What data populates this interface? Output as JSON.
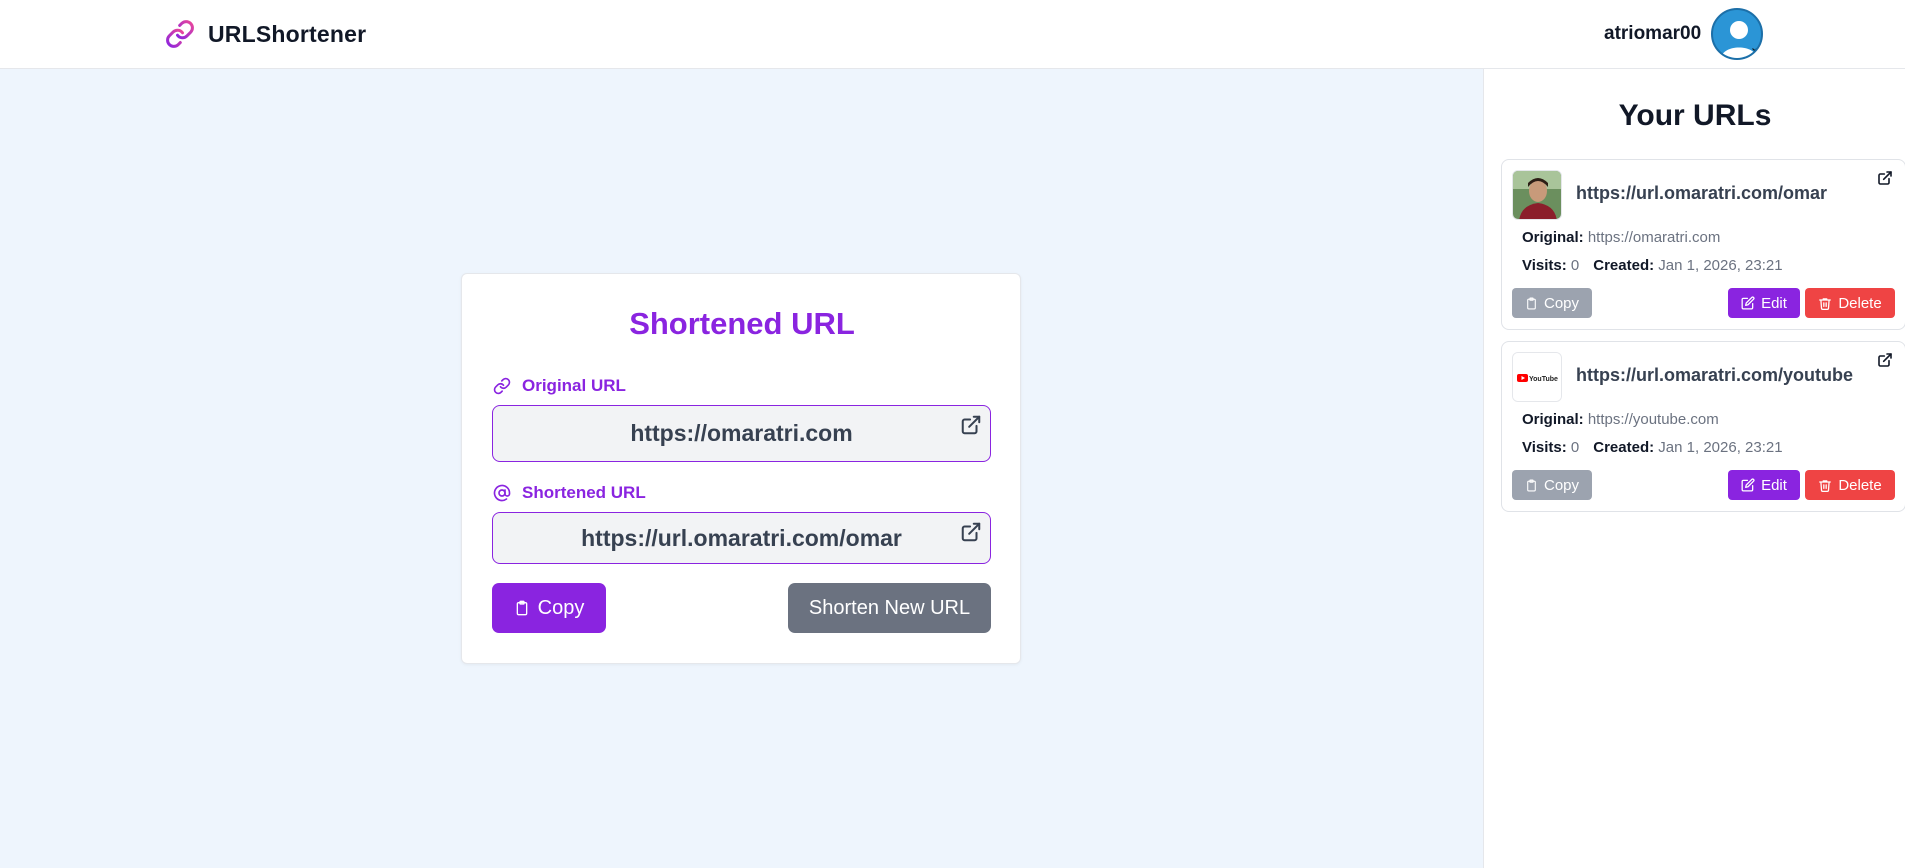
{
  "header": {
    "brand": "URLShortener",
    "username": "atriomar00",
    "avatar_chevron": "⌄"
  },
  "colors": {
    "accent": "#8a24e0",
    "background": "#eef5fd",
    "gray_button": "#6b7280",
    "danger": "#ef4444",
    "avatar": "#2b95d6"
  },
  "card": {
    "title": "Shortened URL",
    "original": {
      "label": "Original URL",
      "icon": "link-icon",
      "value": "https://omaratri.com"
    },
    "shortened": {
      "label": "Shortened URL",
      "icon": "at-icon",
      "value": "https://url.omaratri.com/omar"
    },
    "copy_label": "Copy",
    "new_label": "Shorten New URL"
  },
  "sidebar": {
    "title": "Your URLs",
    "items": [
      {
        "short": "https://url.omaratri.com/omar",
        "original_label": "Original:",
        "original": "https://omaratri.com",
        "visits_label": "Visits:",
        "visits": "0",
        "created_label": "Created:",
        "created": "Jan 1, 2026, 23:21",
        "thumb": "profile-photo",
        "copy": "Copy",
        "edit": "Edit",
        "delete": "Delete"
      },
      {
        "short": "https://url.omaratri.com/youtube",
        "original_label": "Original:",
        "original": "https://youtube.com",
        "visits_label": "Visits:",
        "visits": "0",
        "created_label": "Created:",
        "created": "Jan 1, 2026, 23:21",
        "thumb": "youtube-logo",
        "thumb_text": "YouTube",
        "copy": "Copy",
        "edit": "Edit",
        "delete": "Delete"
      }
    ]
  }
}
